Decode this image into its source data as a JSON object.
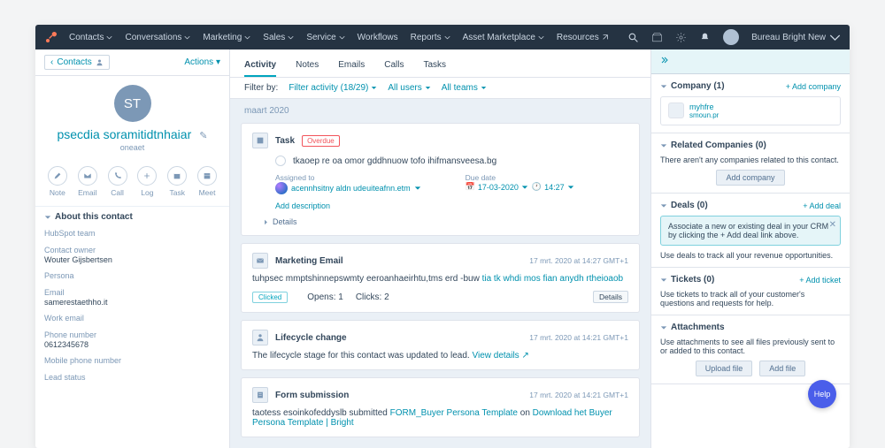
{
  "nav": {
    "items": [
      "Contacts",
      "Conversations",
      "Marketing",
      "Sales",
      "Service",
      "Workflows",
      "Reports",
      "Asset Marketplace",
      "Resources"
    ],
    "account": "Bureau Bright New"
  },
  "left": {
    "back": "Contacts",
    "actions": "Actions",
    "avatar_initials": "ST",
    "name": "psecdia soramitidtnhaiar",
    "subtitle": "oneaet",
    "buttons": [
      {
        "label": "Note"
      },
      {
        "label": "Email"
      },
      {
        "label": "Call"
      },
      {
        "label": "Log"
      },
      {
        "label": "Task"
      },
      {
        "label": "Meet"
      }
    ],
    "about_header": "About this contact",
    "fields": [
      {
        "label": "HubSpot team",
        "value": ""
      },
      {
        "label": "Contact owner",
        "value": "Wouter Gijsbertsen"
      },
      {
        "label": "Persona",
        "value": ""
      },
      {
        "label": "Email",
        "value": "samerestaethho.it"
      },
      {
        "label": "Work email",
        "value": ""
      },
      {
        "label": "Phone number",
        "value": "0612345678"
      },
      {
        "label": "Mobile phone number",
        "value": ""
      },
      {
        "label": "Lead status",
        "value": ""
      }
    ]
  },
  "mid": {
    "tabs": [
      "Activity",
      "Notes",
      "Emails",
      "Calls",
      "Tasks"
    ],
    "filter_label": "Filter by:",
    "filter_activity": "Filter activity (18/29)",
    "filter_users": "All users",
    "filter_teams": "All teams",
    "month": "maart 2020",
    "task": {
      "type": "Task",
      "overdue": "Overdue",
      "title": "tkaoep re oa omor gddhnuow tofo ihifmansveesa.bg",
      "assigned_label": "Assigned to",
      "assignee": "acennhsitny aldn udeuiteafnn.etm",
      "due_label": "Due date",
      "due_date": "17-03-2020",
      "due_time": "14:27",
      "add_description": "Add description",
      "details": "Details"
    },
    "email": {
      "type": "Marketing Email",
      "timestamp": "17 mrt. 2020 at 14:27 GMT+1",
      "body_a": "tuhpsec mmptshinnepswmty eeroanhaeirhtu,tms erd -buw ",
      "body_link": "tia tk whdi mos fian anydh rtheioaob",
      "clicked": "Clicked",
      "opens_label": "Opens:",
      "opens_value": "1",
      "clicks_label": "Clicks:",
      "clicks_value": "2",
      "details": "Details"
    },
    "lifecycle": {
      "type": "Lifecycle change",
      "timestamp": "17 mrt. 2020 at 14:21 GMT+1",
      "body": "The lifecycle stage for this contact was updated to lead. ",
      "link": "View details"
    },
    "form": {
      "type": "Form submission",
      "timestamp": "17 mrt. 2020 at 14:21 GMT+1",
      "body_a": "taotess esoinkofeddyslb submitted ",
      "link1": "FORM_Buyer Persona Template",
      "body_b": " on ",
      "link2": "Download het Buyer Persona Template | Bright"
    }
  },
  "right": {
    "company": {
      "title": "Company (1)",
      "add": "+ Add company",
      "name": "myhfre",
      "domain": "smoun.pr"
    },
    "related": {
      "title": "Related Companies (0)",
      "body": "There aren't any companies related to this contact.",
      "btn": "Add company"
    },
    "deals": {
      "title": "Deals (0)",
      "add": "+ Add deal",
      "tip": "Associate a new or existing deal in your CRM by clicking the + Add deal link above.",
      "body": "Use deals to track all your revenue opportunities."
    },
    "tickets": {
      "title": "Tickets (0)",
      "add": "+ Add ticket",
      "body": "Use tickets to track all of your customer's questions and requests for help."
    },
    "attachments": {
      "title": "Attachments",
      "body": "Use attachments to see all files previously sent to or added to this contact.",
      "upload": "Upload file",
      "addfile": "Add file"
    }
  },
  "help": "Help"
}
